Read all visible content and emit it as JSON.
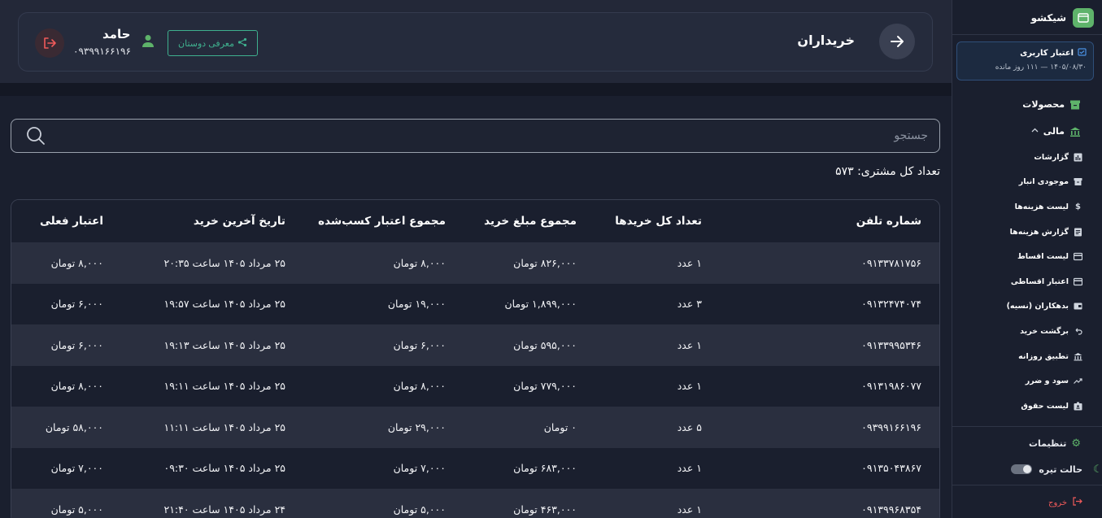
{
  "sidebar": {
    "brand": "شیکشو",
    "credit": {
      "title": "اعتبار کاربری",
      "subtitle": "۱۴۰۵/۰۸/۳۰ — ۱۱۱ روز مانده"
    },
    "items": [
      {
        "label": "محصولات",
        "icon": "archive-icon"
      },
      {
        "label": "مالی",
        "icon": "bank-icon"
      }
    ],
    "sub_items": [
      {
        "label": "گزارشات",
        "icon": "bar-chart-icon"
      },
      {
        "label": "موجودی انبار",
        "icon": "archive-icon"
      },
      {
        "label": "لیست هزینه‌ها",
        "icon": "dollar-icon"
      },
      {
        "label": "گزارش هزینه‌ها",
        "icon": "receipt-icon"
      },
      {
        "label": "لیست اقساط",
        "icon": "card-icon"
      },
      {
        "label": "اعتبار اقساطی",
        "icon": "card-icon"
      },
      {
        "label": "بدهکاران (نسیه)",
        "icon": "wallet-icon"
      },
      {
        "label": "برگشت خرید",
        "icon": "undo-icon"
      },
      {
        "label": "تطبیق روزانه",
        "icon": "bank-icon"
      },
      {
        "label": "سود و ضرر",
        "icon": "trend-icon"
      },
      {
        "label": "لیست حقوق",
        "icon": "badge-icon"
      }
    ],
    "settings": "تنظیمات",
    "dark_mode": "حالت تیره",
    "logout": "خروج"
  },
  "header": {
    "title": "خریداران",
    "user_name": "حامد",
    "user_phone": "۰۹۳۹۹۱۶۶۱۹۶",
    "invite_label": "معرفی دوستان"
  },
  "search": {
    "placeholder": "جستجو"
  },
  "summary": {
    "total_customers": "تعداد کل مشتری: ۵۷۳"
  },
  "table": {
    "columns": [
      "شماره تلفن",
      "تعداد کل خریدها",
      "مجموع مبلغ خرید",
      "مجموع اعتبار کسب‌شده",
      "تاریخ آخرین خرید",
      "اعتبار فعلی"
    ],
    "rows": [
      [
        "۰۹۱۳۳۷۸۱۷۵۶",
        "۱ عدد",
        "۸۲۶,۰۰۰ تومان",
        "۸,۰۰۰ تومان",
        "۲۵ مرداد ۱۴۰۵ ساعت ۲۰:۳۵",
        "۸,۰۰۰ تومان"
      ],
      [
        "۰۹۱۳۲۴۷۴۰۷۴",
        "۳ عدد",
        "۱,۸۹۹,۰۰۰ تومان",
        "۱۹,۰۰۰ تومان",
        "۲۵ مرداد ۱۴۰۵ ساعت ۱۹:۵۷",
        "۶,۰۰۰ تومان"
      ],
      [
        "۰۹۱۳۳۹۹۵۳۴۶",
        "۱ عدد",
        "۵۹۵,۰۰۰ تومان",
        "۶,۰۰۰ تومان",
        "۲۵ مرداد ۱۴۰۵ ساعت ۱۹:۱۳",
        "۶,۰۰۰ تومان"
      ],
      [
        "۰۹۱۳۱۹۸۶۰۷۷",
        "۱ عدد",
        "۷۷۹,۰۰۰ تومان",
        "۸,۰۰۰ تومان",
        "۲۵ مرداد ۱۴۰۵ ساعت ۱۹:۱۱",
        "۸,۰۰۰ تومان"
      ],
      [
        "۰۹۳۹۹۱۶۶۱۹۶",
        "۵ عدد",
        "۰ تومان",
        "۲۹,۰۰۰ تومان",
        "۲۵ مرداد ۱۴۰۵ ساعت ۱۱:۱۱",
        "۵۸,۰۰۰ تومان"
      ],
      [
        "۰۹۱۳۵۰۴۳۸۶۷",
        "۱ عدد",
        "۶۸۳,۰۰۰ تومان",
        "۷,۰۰۰ تومان",
        "۲۵ مرداد ۱۴۰۵ ساعت ۰۹:۳۰",
        "۷,۰۰۰ تومان"
      ],
      [
        "۰۹۱۳۹۹۶۸۳۵۴",
        "۱ عدد",
        "۴۶۳,۰۰۰ تومان",
        "۵,۰۰۰ تومان",
        "۲۴ مرداد ۱۴۰۵ ساعت ۲۱:۴۰",
        "۵,۰۰۰ تومان"
      ]
    ]
  },
  "colors": {
    "accent": "#5eb36a",
    "danger": "#f05a5a",
    "teal": "#3fb08e"
  }
}
